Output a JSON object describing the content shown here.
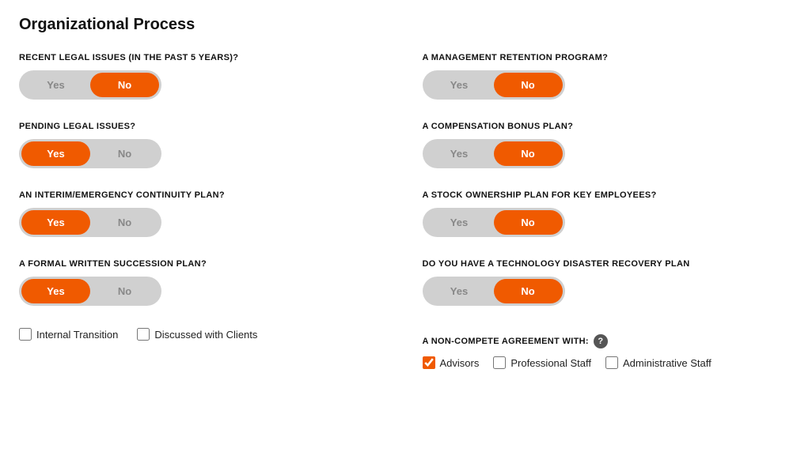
{
  "page": {
    "title": "Organizational Process"
  },
  "questions": {
    "left": [
      {
        "id": "recent-legal",
        "label": "RECENT LEGAL ISSUES (IN THE PAST 5 YEARS)?",
        "yes_active": false,
        "no_active": true
      },
      {
        "id": "pending-legal",
        "label": "PENDING LEGAL ISSUES?",
        "yes_active": true,
        "no_active": false
      },
      {
        "id": "interim-continuity",
        "label": "AN INTERIM/EMERGENCY CONTINUITY PLAN?",
        "yes_active": true,
        "no_active": false
      },
      {
        "id": "formal-succession",
        "label": "A FORMAL WRITTEN SUCCESSION PLAN?",
        "yes_active": true,
        "no_active": false
      }
    ],
    "right": [
      {
        "id": "management-retention",
        "label": "A MANAGEMENT RETENTION PROGRAM?",
        "yes_active": false,
        "no_active": true
      },
      {
        "id": "compensation-bonus",
        "label": "A COMPENSATION BONUS PLAN?",
        "yes_active": false,
        "no_active": true
      },
      {
        "id": "stock-ownership",
        "label": "A STOCK OWNERSHIP PLAN FOR KEY EMPLOYEES?",
        "yes_active": false,
        "no_active": true
      },
      {
        "id": "tech-disaster",
        "label": "DO YOU HAVE A TECHNOLOGY DISASTER RECOVERY PLAN",
        "yes_active": false,
        "no_active": true
      }
    ]
  },
  "succession_checkboxes": {
    "internal_transition": {
      "label": "Internal Transition",
      "checked": false
    },
    "discussed_with_clients": {
      "label": "Discussed with Clients",
      "checked": false
    }
  },
  "non_compete": {
    "label": "A NON-COMPETE AGREEMENT WITH:",
    "help_symbol": "?",
    "options": [
      {
        "id": "advisors",
        "label": "Advisors",
        "checked": true
      },
      {
        "id": "professional-staff",
        "label": "Professional Staff",
        "checked": false
      },
      {
        "id": "administrative-staff",
        "label": "Administrative Staff",
        "checked": false
      }
    ]
  },
  "buttons": {
    "yes": "Yes",
    "no": "No"
  }
}
